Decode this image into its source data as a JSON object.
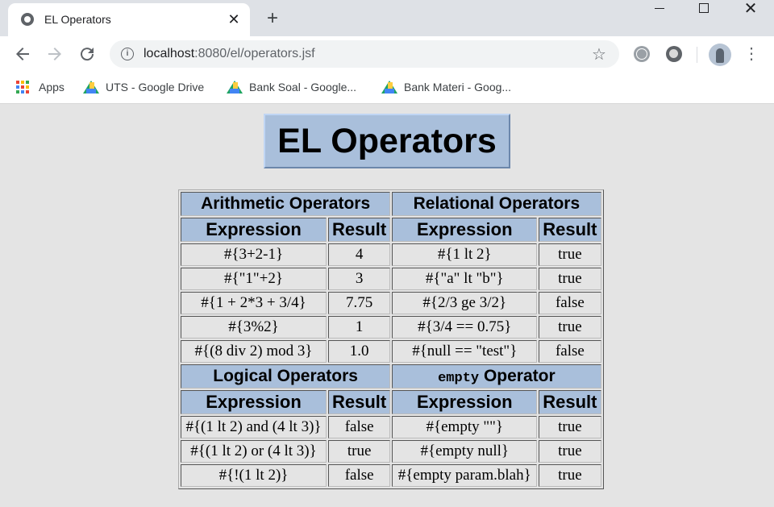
{
  "browser": {
    "tab_title": "EL Operators",
    "tab_close": "✕",
    "new_tab": "+",
    "url_host": "localhost",
    "url_path": ":8080/el/operators.jsf",
    "icons": [
      "globe-icon",
      "close-icon",
      "plus-icon",
      "back-arrow-icon",
      "forward-arrow-icon",
      "reload-icon",
      "info-icon",
      "star-icon",
      "extension-icon",
      "profile-avatar",
      "menu-dots-icon"
    ]
  },
  "bookmarks": [
    {
      "label": "Apps",
      "icon": "apps-grid-icon"
    },
    {
      "label": "UTS - Google Drive",
      "icon": "google-drive-icon"
    },
    {
      "label": "Bank Soal - Google...",
      "icon": "google-drive-icon"
    },
    {
      "label": "Bank Materi - Goog...",
      "icon": "google-drive-icon"
    }
  ],
  "page": {
    "title": "EL Operators",
    "section_arithmetic": "Arithmetic Operators",
    "section_relational": "Relational Operators",
    "section_logical": "Logical Operators",
    "section_empty_keyword": "empty",
    "section_empty_rest": " Operator",
    "col_expression": "Expression",
    "col_result": "Result",
    "rows_top": [
      {
        "expr1": "#{3+2-1}",
        "res1": "4",
        "expr2": "#{1 lt 2}",
        "res2": "true"
      },
      {
        "expr1": "#{\"1\"+2}",
        "res1": "3",
        "expr2": "#{\"a\" lt \"b\"}",
        "res2": "true"
      },
      {
        "expr1": "#{1 + 2*3 + 3/4}",
        "res1": "7.75",
        "expr2": "#{2/3 ge 3/2}",
        "res2": "false"
      },
      {
        "expr1": "#{3%2}",
        "res1": "1",
        "expr2": "#{3/4 == 0.75}",
        "res2": "true"
      },
      {
        "expr1": "#{(8 div 2) mod 3}",
        "res1": "1.0",
        "expr2": "#{null == \"test\"}",
        "res2": "false"
      }
    ],
    "rows_bottom": [
      {
        "expr1": "#{(1 lt 2) and (4 lt 3)}",
        "res1": "false",
        "expr2": "#{empty \"\"}",
        "res2": "true"
      },
      {
        "expr1": "#{(1 lt 2) or (4 lt 3)}",
        "res1": "true",
        "expr2": "#{empty null}",
        "res2": "true"
      },
      {
        "expr1": "#{!(1 lt 2)}",
        "res1": "false",
        "expr2": "#{empty param.blah}",
        "res2": "true"
      }
    ]
  },
  "colors": {
    "header_bg": "#a9bfdb",
    "page_bg": "#e4e4e4",
    "tabstrip_bg": "#dee1e6"
  }
}
